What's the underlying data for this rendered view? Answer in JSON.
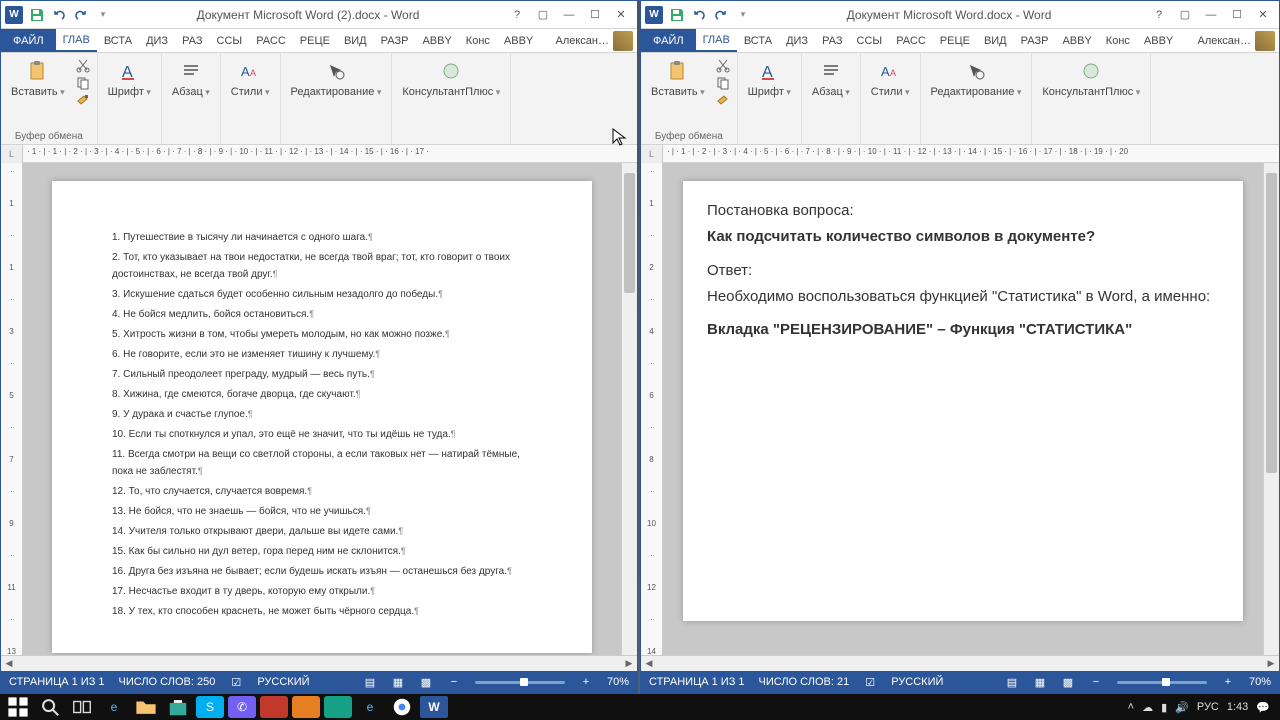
{
  "left": {
    "title": "Документ Microsoft Word (2).docx - Word",
    "tabs": {
      "file": "ФАЙЛ",
      "home": "ГЛАВ",
      "insert": "ВСТА",
      "design": "ДИЗ",
      "layout": "РАЗ",
      "refs": "ССЫ",
      "mail": "РАСС",
      "review": "РЕЦЕ",
      "view": "ВИД",
      "dev": "РАЗР",
      "abby": "ABBY",
      "cons": "Конс",
      "abby2": "ABBY"
    },
    "user": "Алексан…",
    "groups": {
      "clipboard": "Буфер обмена",
      "paste": "Вставить",
      "font": "Шрифт",
      "para": "Абзац",
      "styles": "Стили",
      "editing": "Редактирование",
      "kp": "КонсультантПлюс"
    },
    "lines": [
      "1. Путешествие в тысячу ли начинается с одного шага.",
      "2. Тот, кто указывает на твои недостатки, не всегда твой враг; тот, кто говорит о твоих достоинствах, не всегда твой друг.",
      "3. Искушение сдаться будет особенно сильным незадолго до победы.",
      "4. Не бойся медлить, бойся остановиться.",
      "5. Хитрость жизни в том, чтобы умереть молодым, но как можно позже.",
      "6. Не говорите, если это не изменяет тишину к лучшему.",
      "7. Сильный преодолеет преграду, мудрый — весь путь.",
      "8. Хижина, где смеются, богаче дворца, где скучают.",
      "9. У дурака и счастье глупое.",
      "10. Если ты споткнулся и упал, это ещё не значит, что ты идёшь не туда.",
      "11. Всегда смотри на вещи со светлой стороны, а если таковых нет — натирай тёмные, пока не заблестят.",
      "12. То, что случается, случается вовремя.",
      "13. Не бойся, что не знаешь — бойся, что не учишься.",
      "14. Учителя только открывают двери, дальше вы идете сами.",
      "15. Как бы сильно ни дул ветер, гора перед ним не склонится.",
      "16. Друга без изъяна не бывает; если будешь искать изъян — останешься без друга.",
      "17. Несчастье входит в ту дверь, которую ему открыли.",
      "18. У тех, кто способен краснеть, не может быть чёрного сердца."
    ],
    "status": {
      "page": "СТРАНИЦА 1 ИЗ 1",
      "words": "ЧИСЛО СЛОВ: 250",
      "lang": "РУССКИЙ",
      "zoom": "70%"
    }
  },
  "right": {
    "title": "Документ Microsoft Word.docx - Word",
    "tabs": {
      "file": "ФАЙЛ",
      "home": "ГЛАВ",
      "insert": "ВСТА",
      "design": "ДИЗ",
      "layout": "РАЗ",
      "refs": "ССЫ",
      "mail": "РАСС",
      "review": "РЕЦЕ",
      "view": "ВИД",
      "dev": "РАЗР",
      "abby": "ABBY",
      "cons": "Конс",
      "abby2": "ABBY"
    },
    "user": "Алексан…",
    "groups": {
      "clipboard": "Буфер обмена",
      "paste": "Вставить",
      "font": "Шрифт",
      "para": "Абзац",
      "styles": "Стили",
      "editing": "Редактирование",
      "kp": "КонсультантПлюс"
    },
    "content": {
      "q_label": "Постановка вопроса:",
      "q_text": "Как подсчитать количество символов в документе?",
      "a_label": "Ответ:",
      "a_text": "Необходимо воспользоваться функцией \"Статистика\" в Word, а именно:",
      "a_bold": "Вкладка \"РЕЦЕНЗИРОВАНИЕ\" – Функция \"СТАТИСТИКА\""
    },
    "status": {
      "page": "СТРАНИЦА 1 ИЗ 1",
      "words": "ЧИСЛО СЛОВ: 21",
      "lang": "РУССКИЙ",
      "zoom": "70%"
    }
  },
  "ruler_h": "· 1 · | · 1 · | · 2 · | · 3 · | · 4 · | · 5 · | · 6 · | · 7 · | · 8 · | · 9 · | · 10 · | · 11 · | · 12 · | · 13 · | · 14 · | · 15 · | · 16 · | · 17 ·",
  "ruler_h2": "· | · 1 · | · 2 · | · 3 · | · 4 · | · 5 · | · 6 · | · 7 · | · 8 · | · 9 · | · 10 · | · 11 · | · 12 · | · 13 · | · 14 · | · 15 · | · 16 · | · 17 · | · 18 · | · 19 · | · 20",
  "taskbar": {
    "lang": "РУС",
    "time": "1:43"
  }
}
